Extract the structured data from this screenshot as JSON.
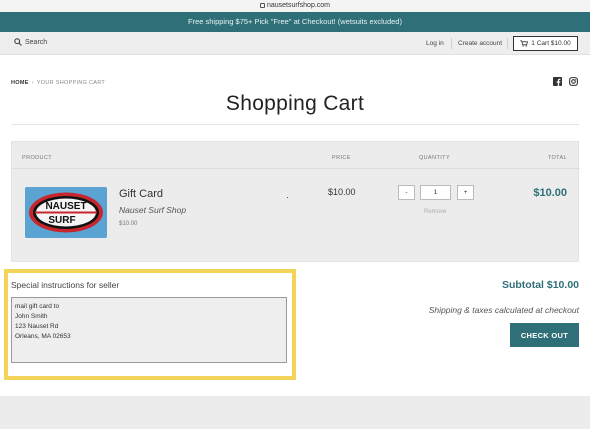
{
  "browser": {
    "url": "nausetsurfshop.com"
  },
  "promo": {
    "text": "Free shipping $75+ Pick \"Free\" at Checkout! (wetsuits excluded)"
  },
  "header": {
    "search_label": "Search",
    "login_label": "Log in",
    "create_account_label": "Create account",
    "cart_label": "1 Cart $10.00"
  },
  "breadcrumb": {
    "home": "HOME",
    "separator": "›",
    "current": "YOUR SHOPPING CART"
  },
  "page": {
    "title": "Shopping Cart"
  },
  "cart": {
    "columns": {
      "product": "PRODUCT",
      "price": "PRICE",
      "quantity": "QUANTITY",
      "total": "TOTAL"
    },
    "item": {
      "title": "Gift Card",
      "vendor": "Nauset Surf Shop",
      "unit_price": "$10.00",
      "price": "$10.00",
      "quantity": "1",
      "minus_label": "-",
      "plus_label": "+",
      "remove_label": "Remove",
      "line_total": "$10.00",
      "logo": {
        "top_word": "NAUSET",
        "bottom_word": "SURF"
      }
    }
  },
  "notes": {
    "label": "Special instructions for seller",
    "value": "mail gift card to\nJohn Smith\n123 Nauset Rd\nOrleans, MA 02653"
  },
  "summary": {
    "subtotal": "Subtotal $10.00",
    "taxes_note": "Shipping & taxes calculated at checkout",
    "checkout_label": "CHECK OUT"
  },
  "colors": {
    "accent": "#2f6f78",
    "highlight": "#f1d458",
    "panel": "#ececec"
  }
}
